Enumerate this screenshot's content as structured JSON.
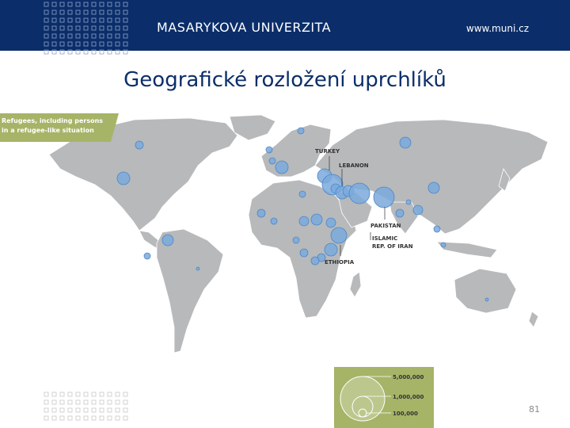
{
  "header": {
    "university": "MASARYKOVA UNIVERZITA",
    "url": "www.muni.cz"
  },
  "slide": {
    "title": "Geografické rozložení uprchlíků",
    "page_number": "81"
  },
  "map": {
    "legend_title_line1": "Refugees, including persons",
    "legend_title_line2": "in a refugee-like situation",
    "labels": {
      "turkey": "TURKEY",
      "lebanon": "LEBANON",
      "pakistan": "PAKISTAN",
      "iran_line1": "ISLAMIC",
      "iran_line2": "REP. OF IRAN",
      "ethiopia": "ETHIOPIA"
    },
    "colors": {
      "ocean": "#ffffff",
      "land": "#b7b9bb",
      "bubble_fill": "#7aa9dc",
      "bubble_stroke": "#4f86c6",
      "banner": "#a6b467"
    }
  },
  "legend": {
    "values": [
      "5,000,000",
      "1,000,000",
      "100,000"
    ],
    "background": "#a6b467"
  }
}
